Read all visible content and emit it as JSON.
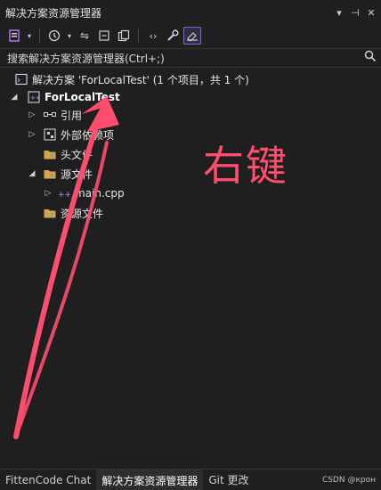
{
  "window": {
    "title": "解决方案资源管理器",
    "controls": [
      "▾",
      "⊣",
      "✕"
    ]
  },
  "search": {
    "placeholder": "搜索解决方案资源管理器(Ctrl+;)"
  },
  "tree": {
    "solution": "解决方案 'ForLocalTest' (1 个项目，共 1 个)",
    "project": "ForLocalTest",
    "items": [
      {
        "label": "引用",
        "icon": "references-icon"
      },
      {
        "label": "外部依赖项",
        "icon": "external-deps-icon"
      },
      {
        "label": "头文件",
        "icon": "filter-folder-icon"
      },
      {
        "label": "源文件",
        "icon": "filter-folder-icon"
      },
      {
        "label": "main.cpp",
        "icon": "cpp-file-icon"
      },
      {
        "label": "资源文件",
        "icon": "filter-folder-icon"
      }
    ]
  },
  "annotation": {
    "text": "右键",
    "color": "#ff4d6d"
  },
  "bottom_tabs": [
    "FittenCode Chat",
    "解决方案资源管理器",
    "Git 更改"
  ],
  "watermark": "CSDN @крон"
}
